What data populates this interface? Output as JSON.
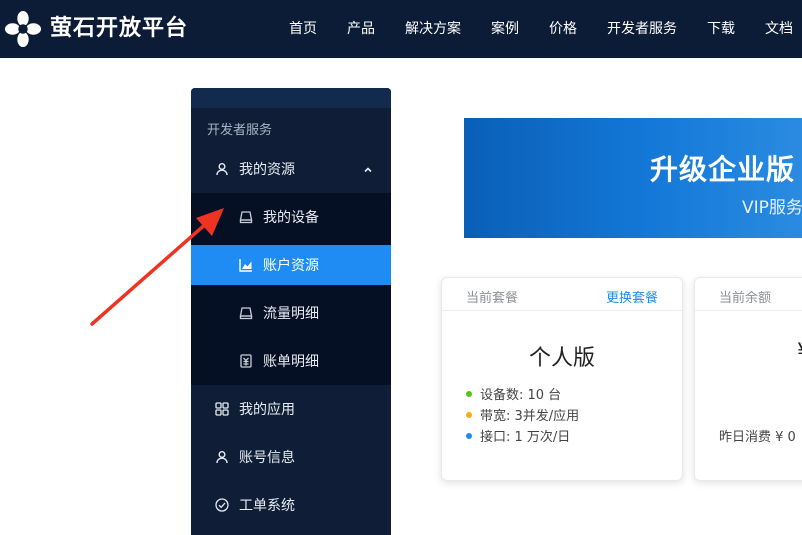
{
  "header": {
    "brand": "萤石开放平台",
    "nav": [
      "首页",
      "产品",
      "解决方案",
      "案例",
      "价格",
      "开发者服务",
      "下载",
      "文档"
    ]
  },
  "sidebar": {
    "section_title": "开发者服务",
    "my_resources": "我的资源",
    "sub_items": [
      {
        "label": "我的设备",
        "icon": "device-icon"
      },
      {
        "label": "账户资源",
        "icon": "chart-icon",
        "active": true
      },
      {
        "label": "流量明细",
        "icon": "device-icon"
      },
      {
        "label": "账单明细",
        "icon": "bill-icon"
      }
    ],
    "items": [
      {
        "label": "我的应用",
        "icon": "grid-icon"
      },
      {
        "label": "账号信息",
        "icon": "user-icon"
      },
      {
        "label": "工单系统",
        "icon": "check-circle-icon"
      }
    ]
  },
  "banner": {
    "title": "升级企业版",
    "subtitle": "VIP服务"
  },
  "plan_card": {
    "label": "当前套餐",
    "link": "更换套餐",
    "plan_name": "个人版",
    "features": [
      {
        "text": "设备数: 10 台",
        "color": "#52c41a"
      },
      {
        "text": "带宽: 3并发/应用",
        "color": "#faad14"
      },
      {
        "text": "接口: 1 万次/日",
        "color": "#1e8cf3"
      }
    ]
  },
  "balance_card": {
    "label": "当前余额",
    "amount": "¥",
    "yesterday": "昨日消费 ¥ 0"
  },
  "colors": {
    "topbar": "#0c1b36",
    "sidebar": "#0f1e36",
    "active": "#1e8cf3",
    "arrow": "#ee3322"
  }
}
